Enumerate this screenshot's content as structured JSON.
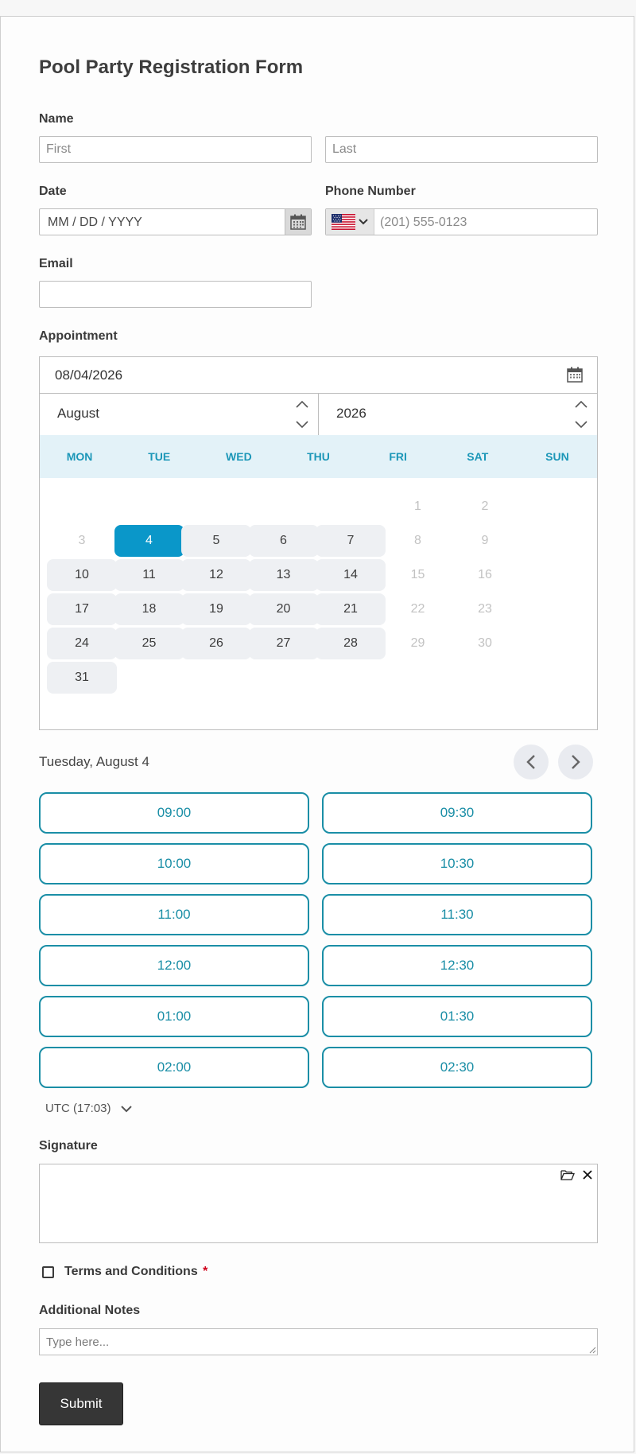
{
  "form": {
    "title": "Pool Party Registration Form",
    "name_label": "Name",
    "first_placeholder": "First",
    "last_placeholder": "Last",
    "date_label": "Date",
    "date_placeholder": "MM / DD / YYYY",
    "phone_label": "Phone Number",
    "phone_placeholder": "(201) 555-0123",
    "phone_country_icon": "us-flag-icon",
    "email_label": "Email",
    "email_value": ""
  },
  "appointment": {
    "label": "Appointment",
    "value": "08/04/2026",
    "month": "August",
    "year": "2026",
    "weekdays": [
      "MON",
      "TUE",
      "WED",
      "THU",
      "FRI",
      "SAT",
      "SUN"
    ],
    "weeks": [
      [
        "",
        "",
        "",
        "",
        "",
        "1",
        "2"
      ],
      [
        "3",
        "4",
        "5",
        "6",
        "7",
        "8",
        "9"
      ],
      [
        "10",
        "11",
        "12",
        "13",
        "14",
        "15",
        "16"
      ],
      [
        "17",
        "18",
        "19",
        "20",
        "21",
        "22",
        "23"
      ],
      [
        "24",
        "25",
        "26",
        "27",
        "28",
        "29",
        "30"
      ],
      [
        "31",
        "",
        "",
        "",
        "",
        "",
        ""
      ]
    ],
    "unavailable_days": [
      "1",
      "2",
      "3",
      "8",
      "9",
      "15",
      "16",
      "22",
      "23",
      "29",
      "30"
    ],
    "selected_day": "4",
    "selected_date_text": "Tuesday, August 4",
    "slots": [
      "09:00",
      "09:30",
      "10:00",
      "10:30",
      "11:00",
      "11:30",
      "12:00",
      "12:30",
      "01:00",
      "01:30",
      "02:00",
      "02:30"
    ],
    "timezone": "UTC (17:03)",
    "colors": {
      "accent": "#0a97c9",
      "slot": "#1a8ea6",
      "header_bg": "#e3f2f8"
    }
  },
  "signature": {
    "label": "Signature"
  },
  "terms": {
    "label": "Terms and Conditions",
    "required_mark": "*"
  },
  "notes": {
    "label": "Additional Notes",
    "placeholder": "Type here..."
  },
  "submit": {
    "label": "Submit"
  }
}
